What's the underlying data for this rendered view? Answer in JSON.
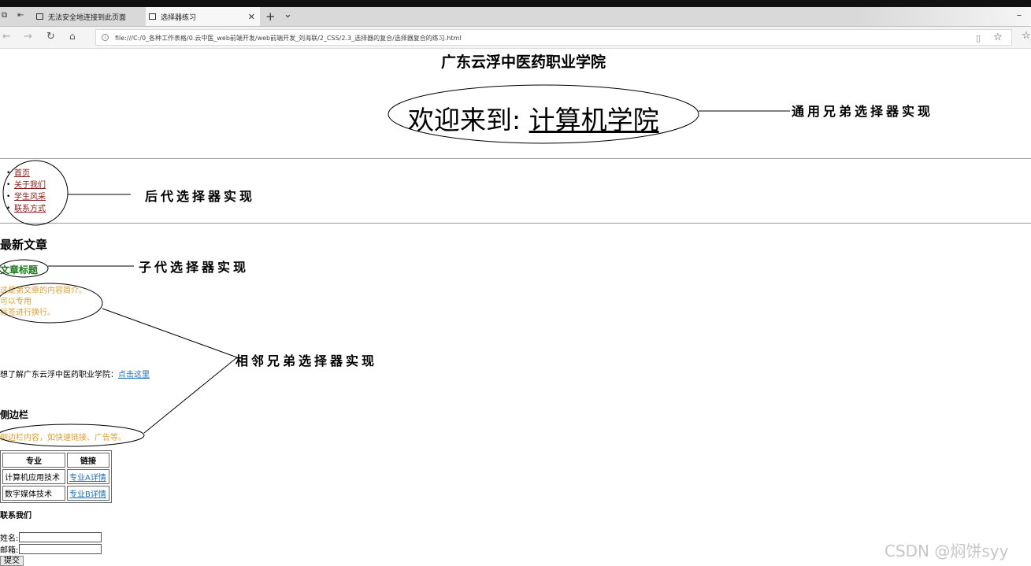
{
  "browser": {
    "tabs": [
      {
        "label": "无法安全地连接到此页面"
      },
      {
        "label": "选择器练习",
        "close": "✕"
      }
    ],
    "new_tab": "+",
    "tab_menu": "⌄",
    "url": "file:///C:/0_各种工作表格/0.云中医_web前端开发/web前端开发_刘海联/2_CSS/2.3_选择器的复合/选择器复合的练习.html",
    "minimize": "–"
  },
  "page": {
    "school_title": "广东云浮中医药职业学院",
    "welcome_prefix": "欢迎来到: ",
    "welcome_link": "计算机学院",
    "nav": [
      "首页",
      "关于我们",
      "学生风采",
      "联系方式"
    ],
    "articles_heading": "最新文章",
    "article_title": "文章标题",
    "article_lines": [
      "这是第文章的内容简介。",
      "可以专用",
      "标签进行换行。"
    ],
    "learn_text": "想了解广东云浮中医药职业学院：",
    "learn_link": "点击这里",
    "sidebar_heading": "侧边栏",
    "sidebar_text": "侧边栏内容，如快速链接、广告等。",
    "table": {
      "headers": [
        "专业",
        "链接"
      ],
      "rows": [
        [
          "计算机应用技术",
          "专业A详情"
        ],
        [
          "数字媒体技术",
          "专业B详情"
        ]
      ]
    },
    "contact_heading": "联系我们",
    "name_label": "姓名:",
    "email_label": "邮箱:",
    "submit_label": "提交"
  },
  "annotations": {
    "general_sibling": "通用兄弟选择器实现",
    "descendant": "后代选择器实现",
    "child": "子代选择器实现",
    "adjacent_sibling": "相邻兄弟选择器实现"
  },
  "watermark": "CSDN @焖饼syy"
}
